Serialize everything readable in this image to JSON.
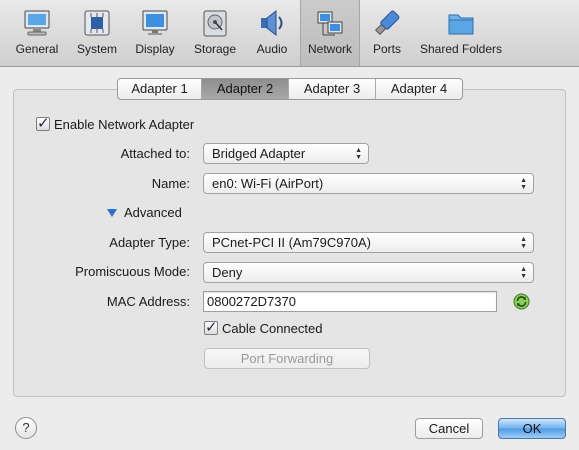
{
  "toolbar": {
    "items": [
      {
        "label": "General",
        "icon": "general-monitor-icon"
      },
      {
        "label": "System",
        "icon": "system-chip-icon"
      },
      {
        "label": "Display",
        "icon": "display-monitor-icon"
      },
      {
        "label": "Storage",
        "icon": "storage-disk-icon"
      },
      {
        "label": "Audio",
        "icon": "audio-speaker-icon"
      },
      {
        "label": "Network",
        "icon": "network-icon"
      },
      {
        "label": "Ports",
        "icon": "ports-icon"
      },
      {
        "label": "Shared Folders",
        "icon": "shared-folders-icon"
      }
    ],
    "active": "Network"
  },
  "tabs": [
    "Adapter 1",
    "Adapter 2",
    "Adapter 3",
    "Adapter 4"
  ],
  "active_tab": "Adapter 2",
  "form": {
    "enable_label": "Enable Network Adapter",
    "enable_checked": true,
    "attached_label": "Attached to:",
    "attached_value": "Bridged Adapter",
    "name_label": "Name:",
    "name_value": "en0: Wi-Fi (AirPort)",
    "advanced_label": "Advanced",
    "adapter_type_label": "Adapter Type:",
    "adapter_type_value": "PCnet-PCI II (Am79C970A)",
    "promiscuous_label": "Promiscuous Mode:",
    "promiscuous_value": "Deny",
    "mac_label": "MAC Address:",
    "mac_value": "0800272D7370",
    "cable_label": "Cable Connected",
    "cable_checked": true,
    "port_forwarding_label": "Port Forwarding"
  },
  "footer": {
    "help_label": "?",
    "cancel_label": "Cancel",
    "ok_label": "OK"
  },
  "colors": {
    "accent": "#4e9ae6",
    "disclosure": "#2a6fd1",
    "refresh_icon": "#3a9a2a"
  }
}
